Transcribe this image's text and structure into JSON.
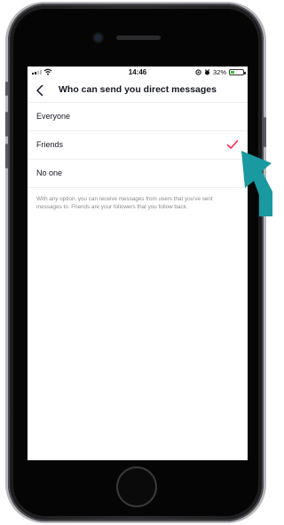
{
  "status_bar": {
    "time": "14:46",
    "battery_percent": "32%",
    "battery_level": 0.32
  },
  "header": {
    "title": "Who can send you direct messages",
    "back_icon": "chevron-left-icon"
  },
  "options": [
    {
      "label": "Everyone",
      "selected": false
    },
    {
      "label": "Friends",
      "selected": true
    },
    {
      "label": "No one",
      "selected": false
    }
  ],
  "note": "With any option, you can receive messages from users that you've sent messages to. Friends are your followers that you follow back.",
  "colors": {
    "accent_check": "#fe2c55",
    "pointer_arrow": "#1a9aa0",
    "battery_fill": "#3cc13b"
  }
}
